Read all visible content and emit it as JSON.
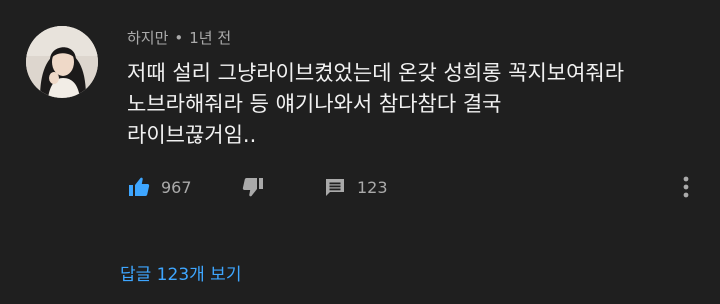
{
  "comment": {
    "author": "하지만",
    "separator": "•",
    "time": "1년 전",
    "text_lines": [
      "저때 설리 그냥라이브켰었는데 온갖 성희롱 꼭지보여줘라",
      "노브라해줘라 등 얘기나와서 참다참다 결국",
      "라이브끊거임.."
    ],
    "like_count": "967",
    "reply_count": "123",
    "view_replies_label": "답글 123개 보기"
  },
  "icons": {
    "like": "thumbs-up-icon",
    "dislike": "thumbs-down-icon",
    "reply": "comment-icon",
    "more": "more-vertical-icon"
  },
  "colors": {
    "background": "#1f1f1f",
    "text": "#f1f1f1",
    "secondary": "#aaaaaa",
    "link": "#3ea6ff",
    "like_active": "#3ea6ff"
  }
}
